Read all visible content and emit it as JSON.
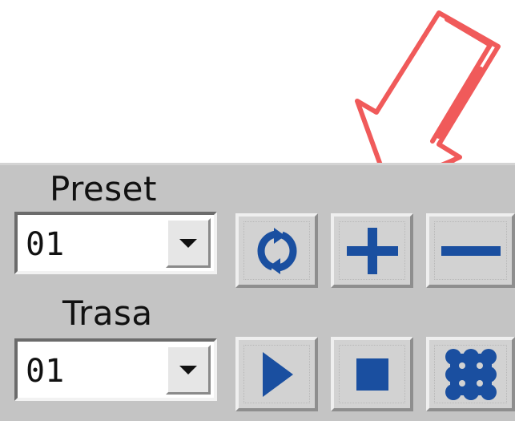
{
  "preset": {
    "label": "Preset",
    "value": "01"
  },
  "trasa": {
    "label": "Trasa",
    "value": "01"
  },
  "icons": {
    "preset_buttons": [
      "refresh-icon",
      "plus-icon",
      "minus-icon"
    ],
    "trasa_buttons": [
      "play-icon",
      "stop-icon",
      "grid-icon"
    ],
    "icon_color": "#1a4fa0"
  },
  "annotation": {
    "arrow_color": "#f05a5a"
  }
}
